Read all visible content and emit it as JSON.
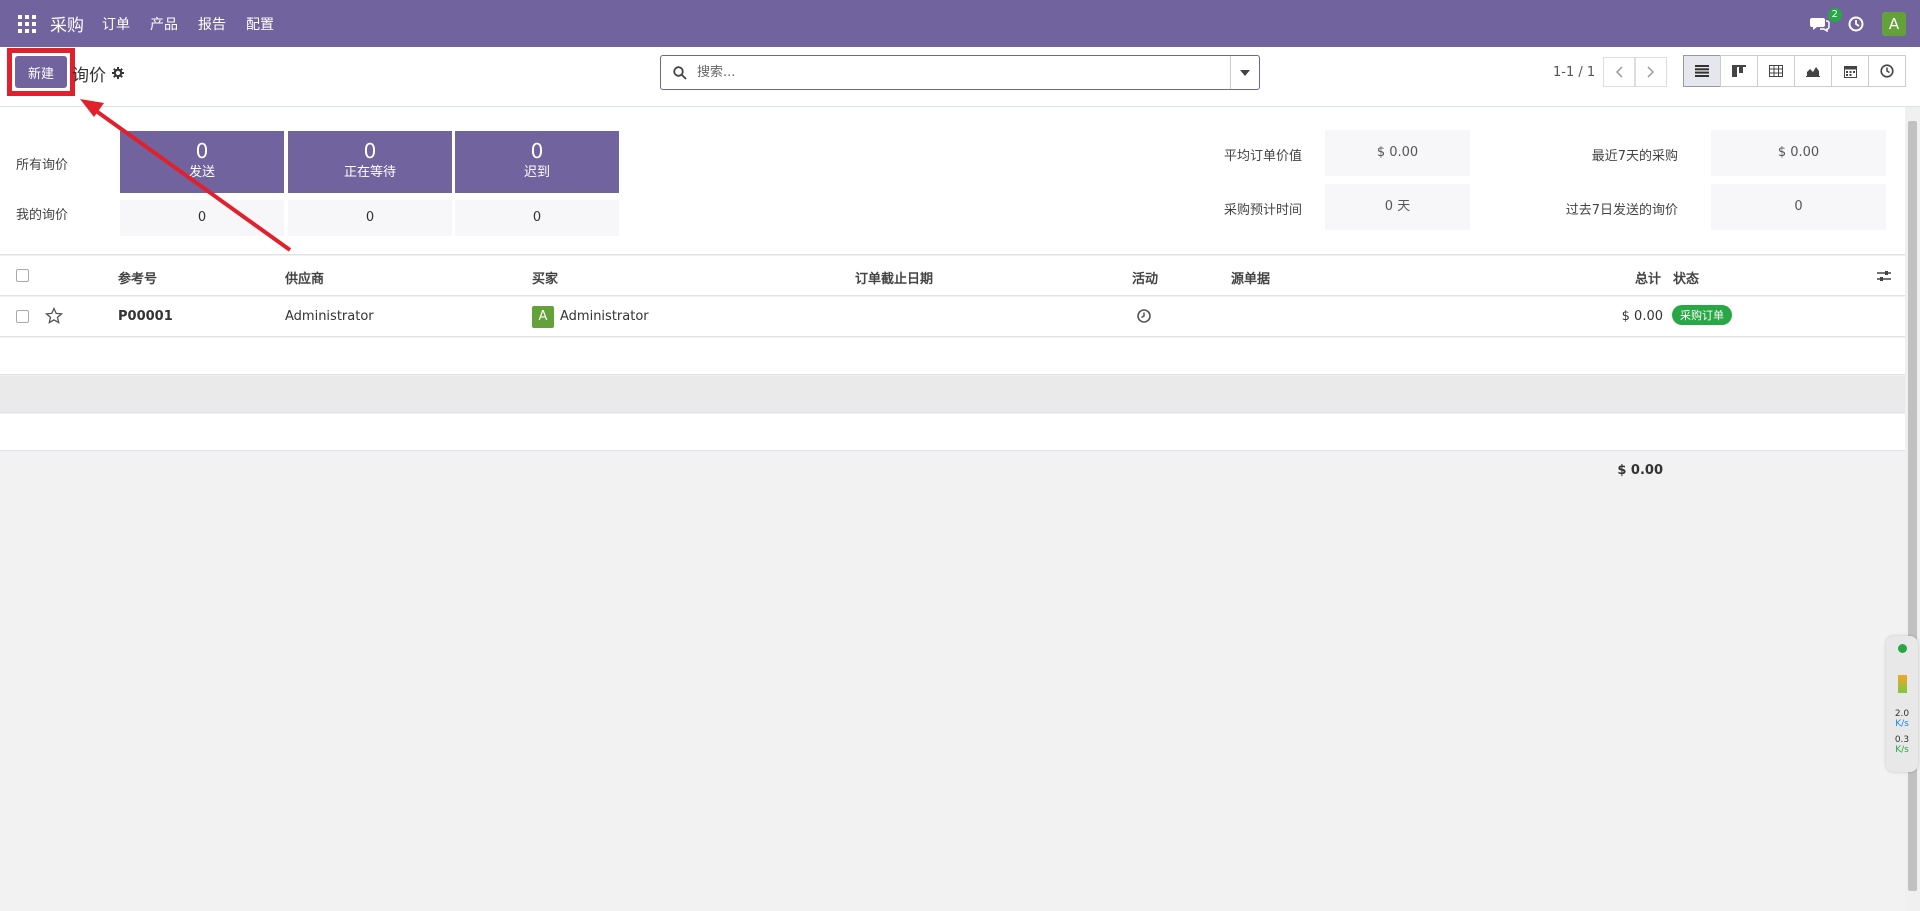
{
  "topbar": {
    "app_title": "采购",
    "menu": [
      "订单",
      "产品",
      "报告",
      "配置"
    ],
    "chat_count": "2",
    "user_initial": "A",
    "bg_color": "#71639e"
  },
  "control": {
    "new_label": "新建",
    "breadcrumb": "询价",
    "search_placeholder": "搜索...",
    "pager": "1-1 / 1"
  },
  "dashboard": {
    "row_labels": {
      "all": "所有询价",
      "mine": "我的询价"
    },
    "tiles": [
      {
        "count": "0",
        "label": "发送",
        "mine": "0"
      },
      {
        "count": "0",
        "label": "正在等待",
        "mine": "0"
      },
      {
        "count": "0",
        "label": "迟到",
        "mine": "0"
      }
    ],
    "kpis": {
      "avg_order_label": "平均订单价值",
      "avg_order_value": "$ 0.00",
      "lead_time_label": "采购预计时间",
      "lead_time_value": "0 天",
      "last7_label": "最近7天的采购",
      "last7_value": "$ 0.00",
      "sent7_label": "过去7日发送的询价",
      "sent7_value": "0"
    }
  },
  "list": {
    "columns": {
      "ref": "参考号",
      "vendor": "供应商",
      "buyer": "买家",
      "deadline": "订单截止日期",
      "activity": "活动",
      "source": "源单据",
      "total": "总计",
      "status": "状态"
    },
    "rows": [
      {
        "ref": "P00001",
        "vendor": "Administrator",
        "buyer_initial": "A",
        "buyer": "Administrator",
        "total": "$ 0.00",
        "status": "采购订单"
      }
    ],
    "grand_total": "$ 0.00"
  },
  "net_widget": {
    "up": "2.0",
    "up_unit": "K/s",
    "down": "0.3",
    "down_unit": "K/s"
  }
}
